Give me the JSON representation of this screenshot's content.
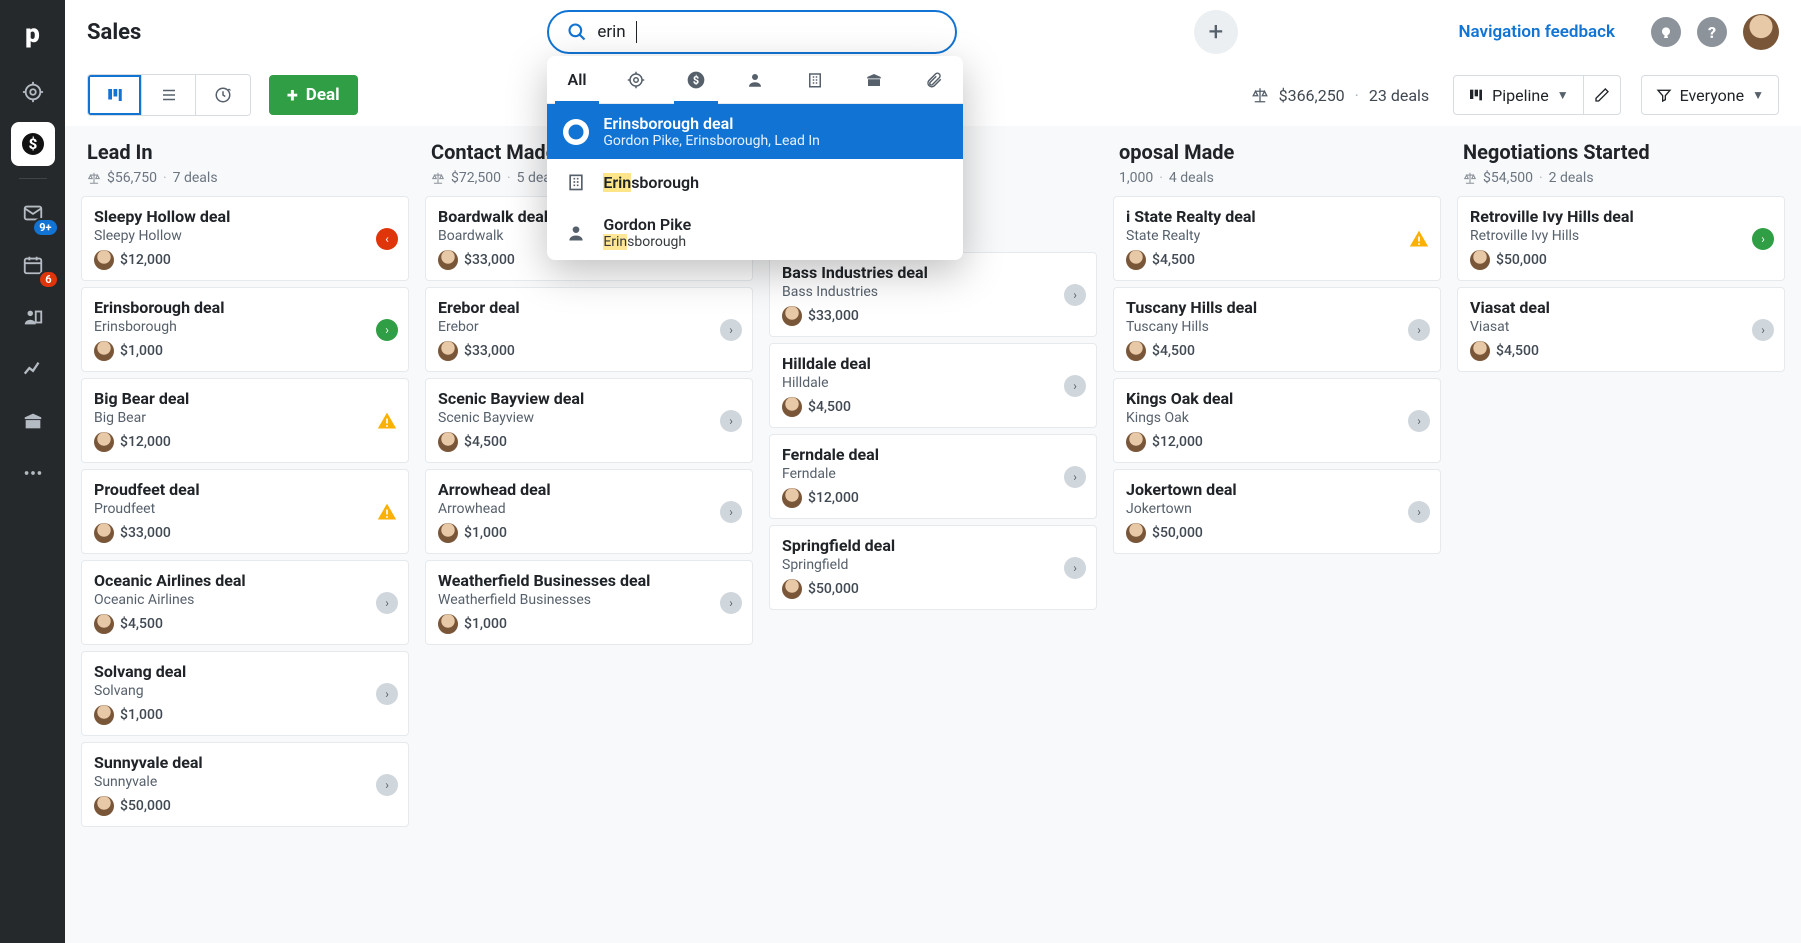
{
  "page_title": "Sales",
  "search": {
    "value": "erin",
    "tooltip": "Deals"
  },
  "nav_feedback": "Navigation feedback",
  "sidebar_badges": {
    "mail": "9+",
    "calendar": "6"
  },
  "toolbar": {
    "deal_button": "Deal",
    "total_amount": "$366,250",
    "deal_count": "23 deals",
    "pipeline_label": "Pipeline",
    "everyone_label": "Everyone"
  },
  "dropdown": {
    "tab_all": "All",
    "results": [
      {
        "icon": "deal",
        "title": "Erinsborough deal",
        "sub": "Gordon Pike, Erinsborough, Lead In",
        "highlighted": true
      },
      {
        "icon": "org",
        "title_pre": "Erin",
        "title_rest": "sborough"
      },
      {
        "icon": "person",
        "title": "Gordon Pike",
        "sub_pre": "Erin",
        "sub_rest": "sborough"
      }
    ]
  },
  "columns": [
    {
      "title": "Lead In",
      "amount": "$56,750",
      "count": "7 deals",
      "cards": [
        {
          "title": "Sleepy Hollow deal",
          "sub": "Sleepy Hollow",
          "amt": "$12,000",
          "ind": "red"
        },
        {
          "title": "Erinsborough deal",
          "sub": "Erinsborough",
          "amt": "$1,000",
          "ind": "green"
        },
        {
          "title": "Big Bear deal",
          "sub": "Big Bear",
          "amt": "$12,000",
          "ind": "warn"
        },
        {
          "title": "Proudfeet deal",
          "sub": "Proudfeet",
          "amt": "$33,000",
          "ind": "warn"
        },
        {
          "title": "Oceanic Airlines deal",
          "sub": "Oceanic Airlines",
          "amt": "$4,500",
          "ind": "gray"
        },
        {
          "title": "Solvang deal",
          "sub": "Solvang",
          "amt": "$1,000",
          "ind": "gray"
        },
        {
          "title": "Sunnyvale deal",
          "sub": "Sunnyvale",
          "amt": "$50,000",
          "ind": "gray"
        }
      ]
    },
    {
      "title": "Contact Made",
      "amount": "$72,500",
      "count": "5 deals",
      "cards": [
        {
          "title": "Boardwalk deal",
          "sub": "Boardwalk",
          "amt": "$33,000",
          "ind": null
        },
        {
          "title": "Erebor deal",
          "sub": "Erebor",
          "amt": "$33,000",
          "ind": "gray"
        },
        {
          "title": "Scenic Bayview deal",
          "sub": "Scenic Bayview",
          "amt": "$4,500",
          "ind": "gray"
        },
        {
          "title": "Arrowhead deal",
          "sub": "Arrowhead",
          "amt": "$1,000",
          "ind": "gray"
        },
        {
          "title": "Weatherfield Businesses deal",
          "sub": "Weatherfield Businesses",
          "amt": "$1,000",
          "ind": "gray"
        }
      ]
    },
    {
      "title": "",
      "amount": "",
      "count": "",
      "cards": [
        {
          "title": "Bass Industries deal",
          "sub": "Bass Industries",
          "amt": "$33,000",
          "ind": "gray"
        },
        {
          "title": "Hilldale deal",
          "sub": "Hilldale",
          "amt": "$4,500",
          "ind": "gray"
        },
        {
          "title": "Ferndale deal",
          "sub": "Ferndale",
          "amt": "$12,000",
          "ind": "gray"
        },
        {
          "title": "Springfield deal",
          "sub": "Springfield",
          "amt": "$50,000",
          "ind": "gray"
        }
      ]
    },
    {
      "title_suffix": "oposal Made",
      "amount_suffix": "1,000",
      "count": "4 deals",
      "cards": [
        {
          "title_suffix": "i State Realty deal",
          "sub_suffix": "State Realty",
          "amt": "$4,500",
          "ind": "warn"
        },
        {
          "title": "Tuscany Hills deal",
          "sub": "Tuscany Hills",
          "amt": "$4,500",
          "ind": "gray"
        },
        {
          "title": "Kings Oak deal",
          "sub": "Kings Oak",
          "amt": "$12,000",
          "ind": "gray"
        },
        {
          "title": "Jokertown deal",
          "sub": "Jokertown",
          "amt": "$50,000",
          "ind": "gray"
        }
      ]
    },
    {
      "title": "Negotiations Started",
      "amount": "$54,500",
      "count": "2 deals",
      "cards": [
        {
          "title": "Retroville Ivy Hills deal",
          "sub": "Retroville Ivy Hills",
          "amt": "$50,000",
          "ind": "green"
        },
        {
          "title": "Viasat deal",
          "sub": "Viasat",
          "amt": "$4,500",
          "ind": "gray"
        }
      ]
    }
  ]
}
